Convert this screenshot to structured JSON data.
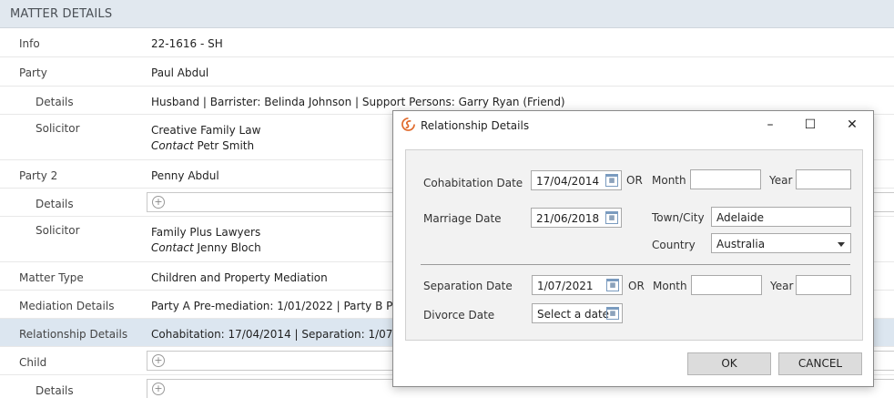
{
  "header": {
    "title": "MATTER DETAILS"
  },
  "rows": [
    {
      "label": "Info",
      "value": "22-1616 - SH"
    },
    {
      "label": "Party",
      "value": "Paul Abdul"
    },
    {
      "label": "Details",
      "value": "Husband  |  Barrister: Belinda Johnson  |  Support Persons: Garry Ryan (Friend)"
    },
    {
      "label": "Solicitor",
      "value": "Creative Family Law",
      "contact_label": "Contact",
      "contact": "Petr Smith"
    },
    {
      "label": "Party 2",
      "value": "Penny Abdul"
    },
    {
      "label": "Details"
    },
    {
      "label": "Solicitor",
      "value": "Family Plus Lawyers",
      "contact_label": "Contact",
      "contact": "Jenny Bloch"
    },
    {
      "label": "Matter Type",
      "value": "Children and Property Mediation"
    },
    {
      "label": "Mediation Details",
      "value": "Party A Pre-mediation: 1/01/2022  |  Party B Pre"
    },
    {
      "label": "Relationship Details",
      "value": "Cohabitation: 17/04/2014 | Separation: 1/07/20"
    },
    {
      "label": "Child"
    },
    {
      "label": "Details"
    }
  ],
  "dialog": {
    "title": "Relationship Details",
    "minimize": "–",
    "maximize": "☐",
    "close": "✕",
    "cohabitation_label": "Cohabitation Date",
    "cohabitation_value": "17/04/2014",
    "marriage_label": "Marriage Date",
    "marriage_value": "21/06/2018",
    "or_label": "OR",
    "month_label": "Month",
    "year_label": "Year",
    "town_label": "Town/City",
    "town_value": "Adelaide",
    "country_label": "Country",
    "country_value": "Australia",
    "separation_label": "Separation Date",
    "separation_value": "1/07/2021",
    "divorce_label": "Divorce Date",
    "divorce_placeholder": "Select a date",
    "ok_label": "OK",
    "cancel_label": "CANCEL"
  },
  "colors": {
    "header_bg": "#e1e8ef",
    "selected_row": "#dce6f0",
    "logo": "#e06a2c"
  }
}
